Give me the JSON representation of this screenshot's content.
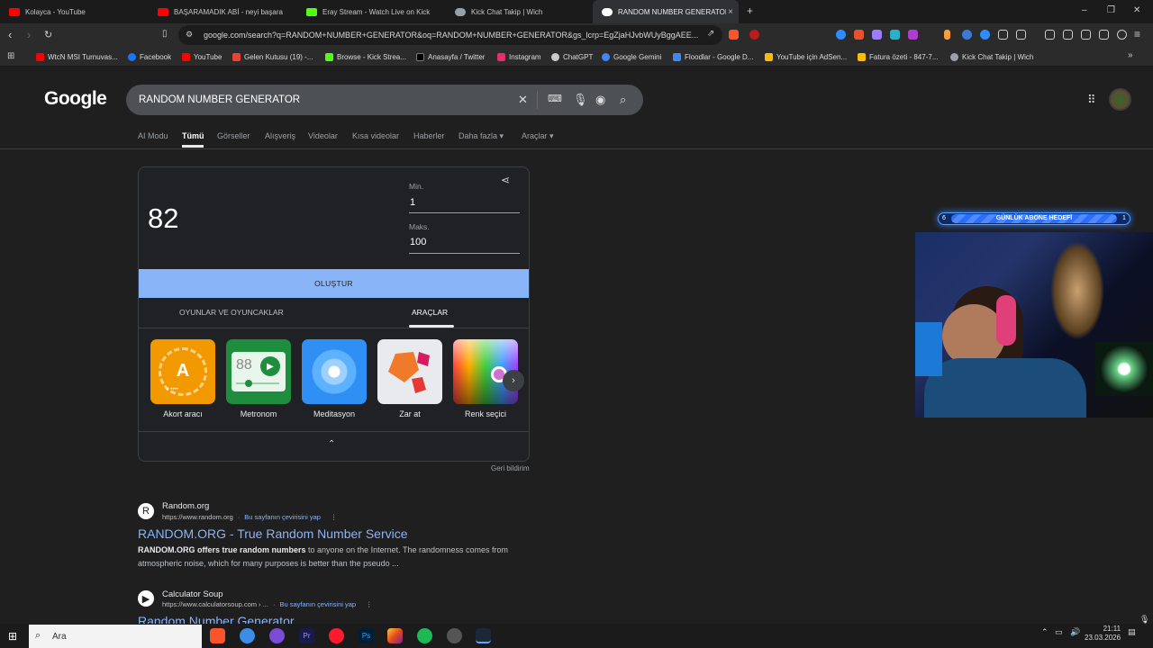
{
  "tabs": [
    {
      "title": "Kolayca - YouTube",
      "color": "#ff0000"
    },
    {
      "title": "BAŞARAMADIK ABİ - neyi başara",
      "color": "#ff0000"
    },
    {
      "title": "Eray Stream - Watch Live on Kick",
      "color": "#53fc18"
    },
    {
      "title": "Kick Chat Takip | Wich",
      "color": "#9aa0a6"
    },
    {
      "title": "RANDOM NUMBER GENERATOR",
      "color": "#ffffff"
    }
  ],
  "tab_close": "×",
  "new_tab": "+",
  "window_controls": [
    "–",
    "❐",
    "✕"
  ],
  "address": {
    "url": "google.com/search?q=RANDOM+NUMBER+GENERATOR&oq=RANDOM+NUMBER+GENERATOR&gs_lcrp=EgZjaHJvbWUyBggAEE..."
  },
  "bookmarks": [
    {
      "label": "WtcN MSI Turnuvas...",
      "color": "#ff0000"
    },
    {
      "label": "Facebook",
      "color": "#1877f2"
    },
    {
      "label": "YouTube",
      "color": "#ff0000"
    },
    {
      "label": "Gelen Kutusu (19) -...",
      "color": "#ea4335"
    },
    {
      "label": "Browse - Kick Strea...",
      "color": "#53fc18"
    },
    {
      "label": "Anasayfa / Twitter",
      "color": "#000000"
    },
    {
      "label": "Instagram",
      "color": "#e1306c"
    },
    {
      "label": "ChatGPT",
      "color": "#cccccc"
    },
    {
      "label": "Google Gemini",
      "color": "#4285f4"
    },
    {
      "label": "Floodlar - Google D...",
      "color": "#4285f4"
    },
    {
      "label": "YouTube için AdSen...",
      "color": "#fbbc04"
    },
    {
      "label": "Fatura özeti - 847-7...",
      "color": "#fbbc04"
    },
    {
      "label": "Kick Chat Takip | Wich",
      "color": "#9aa0a6"
    }
  ],
  "bookmarks_more": "»",
  "google": {
    "logo": "Google",
    "query": "RANDOM NUMBER GENERATOR",
    "nav": [
      "AI Modu",
      "Tümü",
      "Görseller",
      "Alışveriş",
      "Videolar",
      "Kısa videolar",
      "Haberler",
      "Daha fazla",
      "Araçlar"
    ]
  },
  "widget": {
    "number": "82",
    "min_label": "Min.",
    "min_value": "1",
    "max_label": "Maks.",
    "max_value": "100",
    "generate": "OLUŞTUR",
    "tab_games": "OYUNLAR VE OYUNCAKLAR",
    "tab_tools": "ARAÇLAR",
    "tools": [
      {
        "label": "Akort aracı",
        "glyph": "A"
      },
      {
        "label": "Metronom",
        "glyph": "88"
      },
      {
        "label": "Meditasyon",
        "glyph": ""
      },
      {
        "label": "Zar at",
        "glyph": ""
      },
      {
        "label": "Renk seçici",
        "glyph": ""
      }
    ],
    "feedback": "Geri bildirim"
  },
  "results": [
    {
      "site": "Random.org",
      "url": "https://www.random.org",
      "translate": "Bu sayfanın çevirisini yap",
      "title": "RANDOM.ORG - True Random Number Service",
      "snippet_bold": "RANDOM.ORG offers true random numbers",
      "snippet": " to anyone on the Internet. The randomness comes from atmospheric noise, which for many purposes is better than the pseudo ...",
      "favicon": "R"
    },
    {
      "site": "Calculator Soup",
      "url": "https://www.calculatorsoup.com › ...",
      "translate": "Bu sayfanın çevirisini yap",
      "title": "Random Number Generator",
      "favicon": "▶"
    }
  ],
  "overlay": {
    "goal_start": "6",
    "goal_label": "GÜNLÜK ABONE HEDEFİ",
    "goal_end": "1",
    "progress": 0.95
  },
  "taskbar": {
    "search": "Ara",
    "time": "21:11",
    "date": "23.03.2026"
  }
}
